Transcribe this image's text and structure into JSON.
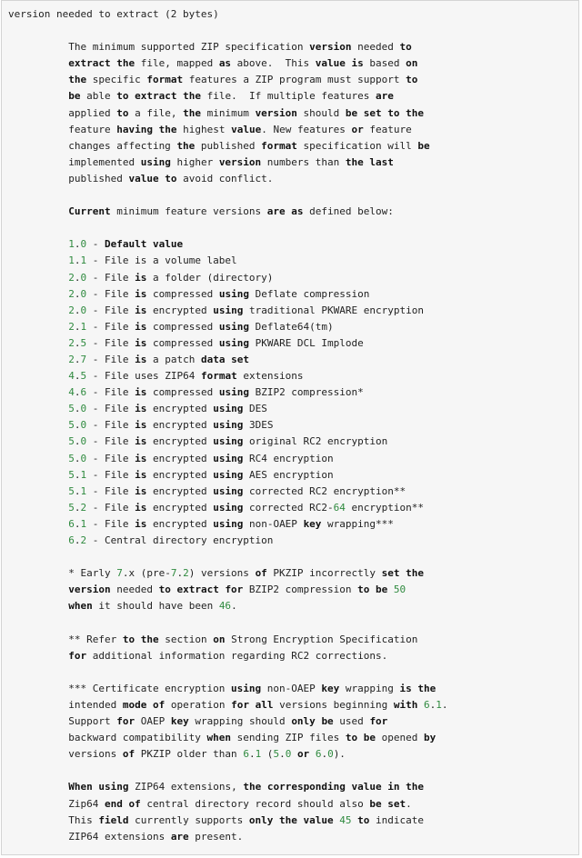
{
  "document": {
    "lines": [
      "version needed to extract (2 bytes)",
      "",
      "          The minimum supported ZIP specification version needed to",
      "          extract the file, mapped as above.  This value is based on",
      "          the specific format features a ZIP program must support to",
      "          be able to extract the file.  If multiple features are",
      "          applied to a file, the minimum version should be set to the",
      "          feature having the highest value. New features or feature",
      "          changes affecting the published format specification will be",
      "          implemented using higher version numbers than the last",
      "          published value to avoid conflict.",
      "",
      "          Current minimum feature versions are as defined below:",
      "",
      "          1.0 - Default value",
      "          1.1 - File is a volume label",
      "          2.0 - File is a folder (directory)",
      "          2.0 - File is compressed using Deflate compression",
      "          2.0 - File is encrypted using traditional PKWARE encryption",
      "          2.1 - File is compressed using Deflate64(tm)",
      "          2.5 - File is compressed using PKWARE DCL Implode",
      "          2.7 - File is a patch data set",
      "          4.5 - File uses ZIP64 format extensions",
      "          4.6 - File is compressed using BZIP2 compression*",
      "          5.0 - File is encrypted using DES",
      "          5.0 - File is encrypted using 3DES",
      "          5.0 - File is encrypted using original RC2 encryption",
      "          5.0 - File is encrypted using RC4 encryption",
      "          5.1 - File is encrypted using AES encryption",
      "          5.1 - File is encrypted using corrected RC2 encryption**",
      "          5.2 - File is encrypted using corrected RC2-64 encryption**",
      "          6.1 - File is encrypted using non-OAEP key wrapping***",
      "          6.2 - Central directory encryption",
      "",
      "          * Early 7.x (pre-7.2) versions of PKZIP incorrectly set the",
      "          version needed to extract for BZIP2 compression to be 50",
      "          when it should have been 46.",
      "",
      "          ** Refer to the section on Strong Encryption Specification",
      "          for additional information regarding RC2 corrections.",
      "",
      "          *** Certificate encryption using non-OAEP key wrapping is the",
      "          intended mode of operation for all versions beginning with 6.1.",
      "          Support for OAEP key wrapping should only be used for",
      "          backward compatibility when sending ZIP files to be opened by",
      "          versions of PKZIP older than 6.1 (5.0 or 6.0).",
      "",
      "          When using ZIP64 extensions, the corresponding value in the",
      "          Zip64 end of central directory record should also be set.",
      "          This field currently supports only the value 45 to indicate",
      "          ZIP64 extensions are present."
    ],
    "highlight_keywords": [
      "version needed to extract",
      "set to",
      "having",
      "value",
      "or",
      "format",
      "using",
      "version",
      "last",
      "to",
      "Current",
      "are",
      "as",
      "Default",
      "is",
      "data",
      "set",
      "of",
      "extract",
      "for",
      "be",
      "when",
      "on",
      "key",
      "mode",
      "all",
      "with",
      "only",
      "by",
      "When",
      "corresponding",
      "in",
      "end",
      "field",
      "the"
    ],
    "colors": {
      "panel_background": "#f6f6f6",
      "panel_border": "#d4d4d4",
      "text": "#222222",
      "number": "#2f8a3f"
    }
  }
}
